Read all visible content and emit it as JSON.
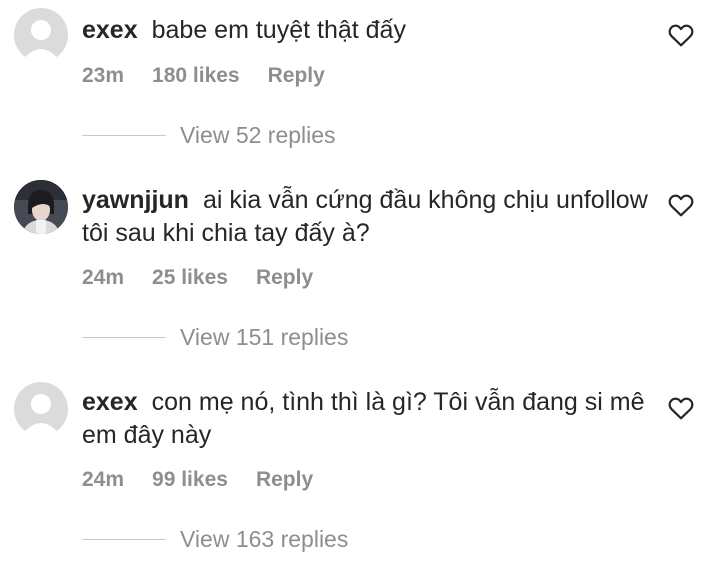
{
  "comments": [
    {
      "username": "exex",
      "text": "babe em tuyệt thật đấy",
      "time": "23m",
      "likes": "180 likes",
      "reply": "Reply",
      "view_replies": "View 52 replies",
      "avatar": "default"
    },
    {
      "username": "yawnjjun",
      "text": "ai kia vẫn cứng đầu không chịu unfollow tôi sau khi chia tay đấy à?",
      "time": "24m",
      "likes": "25 likes",
      "reply": "Reply",
      "view_replies": "View 151 replies",
      "avatar": "photo"
    },
    {
      "username": "exex",
      "text": "con mẹ nó, tình thì là gì? Tôi vẫn đang si mê em đây này",
      "time": "24m",
      "likes": "99 likes",
      "reply": "Reply",
      "view_replies": "View 163 replies",
      "avatar": "default"
    }
  ],
  "icons": {
    "like": "heart-outline-icon",
    "default_avatar": "person-silhouette-icon"
  },
  "colors": {
    "text": "#262626",
    "meta": "#8e8e8e",
    "avatar_bg": "#dbdbdb"
  }
}
